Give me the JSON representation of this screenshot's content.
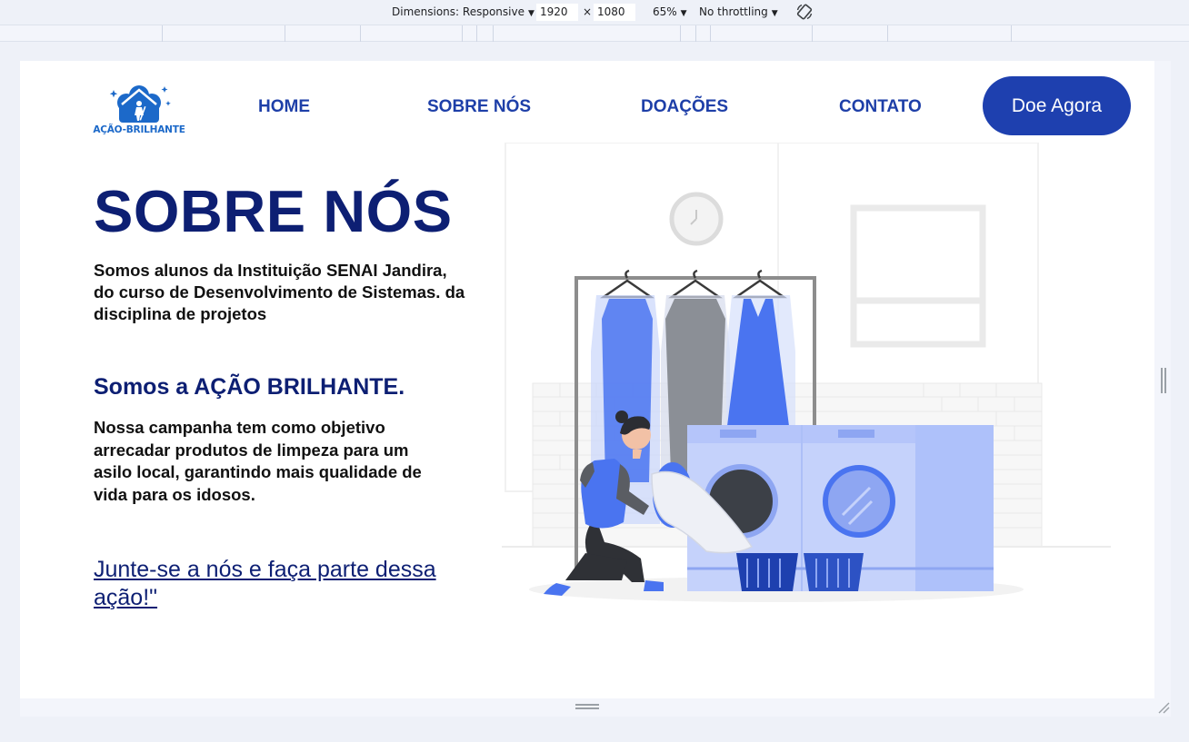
{
  "devtools": {
    "dimensions_label": "Dimensions: Responsive",
    "width_value": "1920",
    "times": "×",
    "height_value": "1080",
    "zoom": "65%",
    "throttling": "No throttling"
  },
  "site": {
    "logo_text": "AÇÃO-BRILHANTE",
    "nav": [
      "HOME",
      "SOBRE NÓS",
      "DOAÇÕES",
      "CONTATO"
    ],
    "cta_label": "Doe Agora",
    "title": "SOBRE NÓS",
    "intro": "Somos alunos da Instituição SENAI Jandira, do curso de Desenvolvimento de Sistemas. da disciplina de projetos",
    "subtitle": "Somos a AÇÃO BRILHANTE.",
    "mission": "Nossa campanha tem como objetivo arrecadar produtos de limpeza para um asilo local, garantindo mais qualidade de vida para os idosos.",
    "join_link": "Junte-se a nós e faça parte dessa ação!\""
  },
  "colors": {
    "brand_dark": "#0d1f73",
    "brand": "#1e40af",
    "nav": "#1e3fa8",
    "logo": "#1c69c9",
    "illustration_accent": "#4a74f0"
  },
  "icons": {
    "logo": "house-cleaner-logo-icon",
    "rotate": "rotate-device-icon",
    "caret": "chevron-down-icon"
  }
}
